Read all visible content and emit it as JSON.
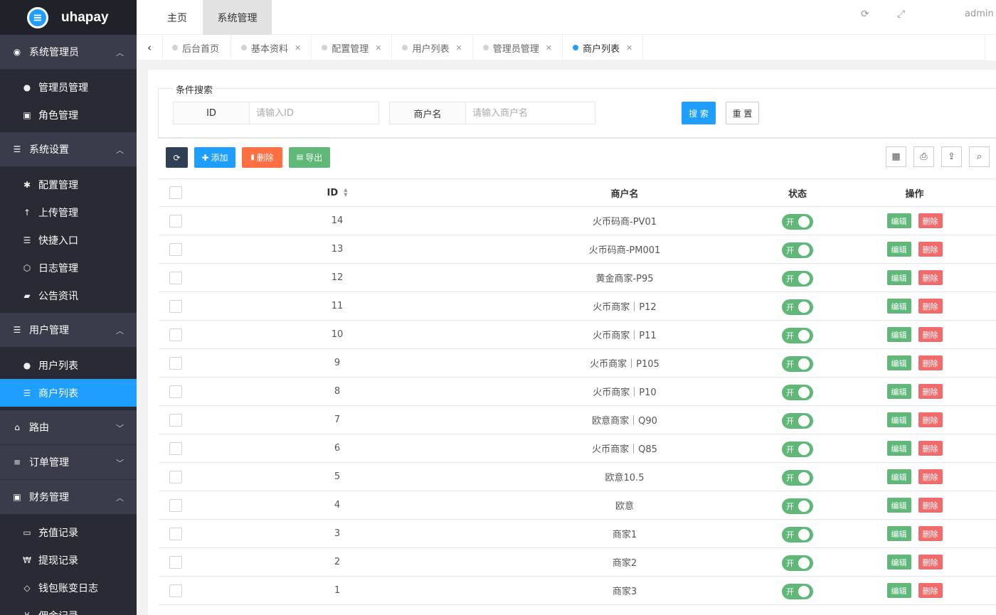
{
  "brand": {
    "name": "uhapay"
  },
  "sidebar": {
    "groups": [
      {
        "label": "系统管理员",
        "icon": "user-circle-icon",
        "expanded": true,
        "items": [
          {
            "label": "管理员管理",
            "icon": "user-icon"
          },
          {
            "label": "角色管理",
            "icon": "id-badge-icon"
          }
        ]
      },
      {
        "label": "系统设置",
        "icon": "database-icon",
        "expanded": true,
        "items": [
          {
            "label": "配置管理",
            "icon": "asterisk-icon"
          },
          {
            "label": "上传管理",
            "icon": "arrow-up-icon"
          },
          {
            "label": "快捷入口",
            "icon": "list-icon"
          },
          {
            "label": "日志管理",
            "icon": "gem-outline-icon"
          },
          {
            "label": "公告资讯",
            "icon": "book-icon"
          }
        ]
      },
      {
        "label": "用户管理",
        "icon": "list-icon",
        "expanded": true,
        "items": [
          {
            "label": "用户列表",
            "icon": "users-icon"
          },
          {
            "label": "商户列表",
            "icon": "list-icon",
            "active": true
          }
        ]
      },
      {
        "label": "路由",
        "icon": "bank-icon",
        "expanded": false,
        "items": []
      },
      {
        "label": "订单管理",
        "icon": "bars-icon",
        "expanded": false,
        "items": []
      },
      {
        "label": "财务管理",
        "icon": "money-icon",
        "expanded": true,
        "items": [
          {
            "label": "充值记录",
            "icon": "card-icon"
          },
          {
            "label": "提现记录",
            "icon": "won-icon"
          },
          {
            "label": "钱包账变日志",
            "icon": "diamond-icon"
          },
          {
            "label": "佣金记录",
            "icon": "yen-icon"
          }
        ]
      }
    ]
  },
  "header": {
    "nav_home": "主页",
    "nav_system": "系统管理",
    "user": "admin"
  },
  "tabs": [
    {
      "label": "后台首页",
      "closable": false
    },
    {
      "label": "基本资料",
      "closable": true
    },
    {
      "label": "配置管理",
      "closable": true
    },
    {
      "label": "用户列表",
      "closable": true
    },
    {
      "label": "管理员管理",
      "closable": true
    },
    {
      "label": "商户列表",
      "closable": true,
      "active": true
    }
  ],
  "search": {
    "legend": "条件搜索",
    "id_label": "ID",
    "id_placeholder": "请输入ID",
    "name_label": "商户名",
    "name_placeholder": "请输入商户名",
    "search_button": "搜 索",
    "reset_button": "重 置"
  },
  "toolbar": {
    "add": "添加",
    "delete": "删除",
    "export": "导出"
  },
  "table": {
    "columns": [
      "ID",
      "商户名",
      "状态",
      "操作"
    ],
    "switch_on_label": "开",
    "edit_label": "编辑",
    "delete_label": "删除",
    "rows": [
      {
        "id": "14",
        "name": "火币码商-PV01",
        "status": true
      },
      {
        "id": "13",
        "name": "火币码商-PM001",
        "status": true
      },
      {
        "id": "12",
        "name": "黄金商家-P95",
        "status": true
      },
      {
        "id": "11",
        "name": "火币商家｜P12",
        "status": true
      },
      {
        "id": "10",
        "name": "火币商家｜P11",
        "status": true
      },
      {
        "id": "9",
        "name": "火币商家｜P105",
        "status": true
      },
      {
        "id": "8",
        "name": "火币商家｜P10",
        "status": true
      },
      {
        "id": "7",
        "name": "欧意商家｜Q90",
        "status": true
      },
      {
        "id": "6",
        "name": "火币商家｜Q85",
        "status": true
      },
      {
        "id": "5",
        "name": "欧意10.5",
        "status": true
      },
      {
        "id": "4",
        "name": "欧意",
        "status": true
      },
      {
        "id": "3",
        "name": "商家1",
        "status": true
      },
      {
        "id": "2",
        "name": "商家2",
        "status": true
      },
      {
        "id": "1",
        "name": "商家3",
        "status": true
      }
    ]
  },
  "colors": {
    "primary": "#1e9fff",
    "sidebar_bg": "#20222a",
    "group_bg": "#393d49",
    "success": "#5fb878",
    "danger": "#f26b6b"
  }
}
